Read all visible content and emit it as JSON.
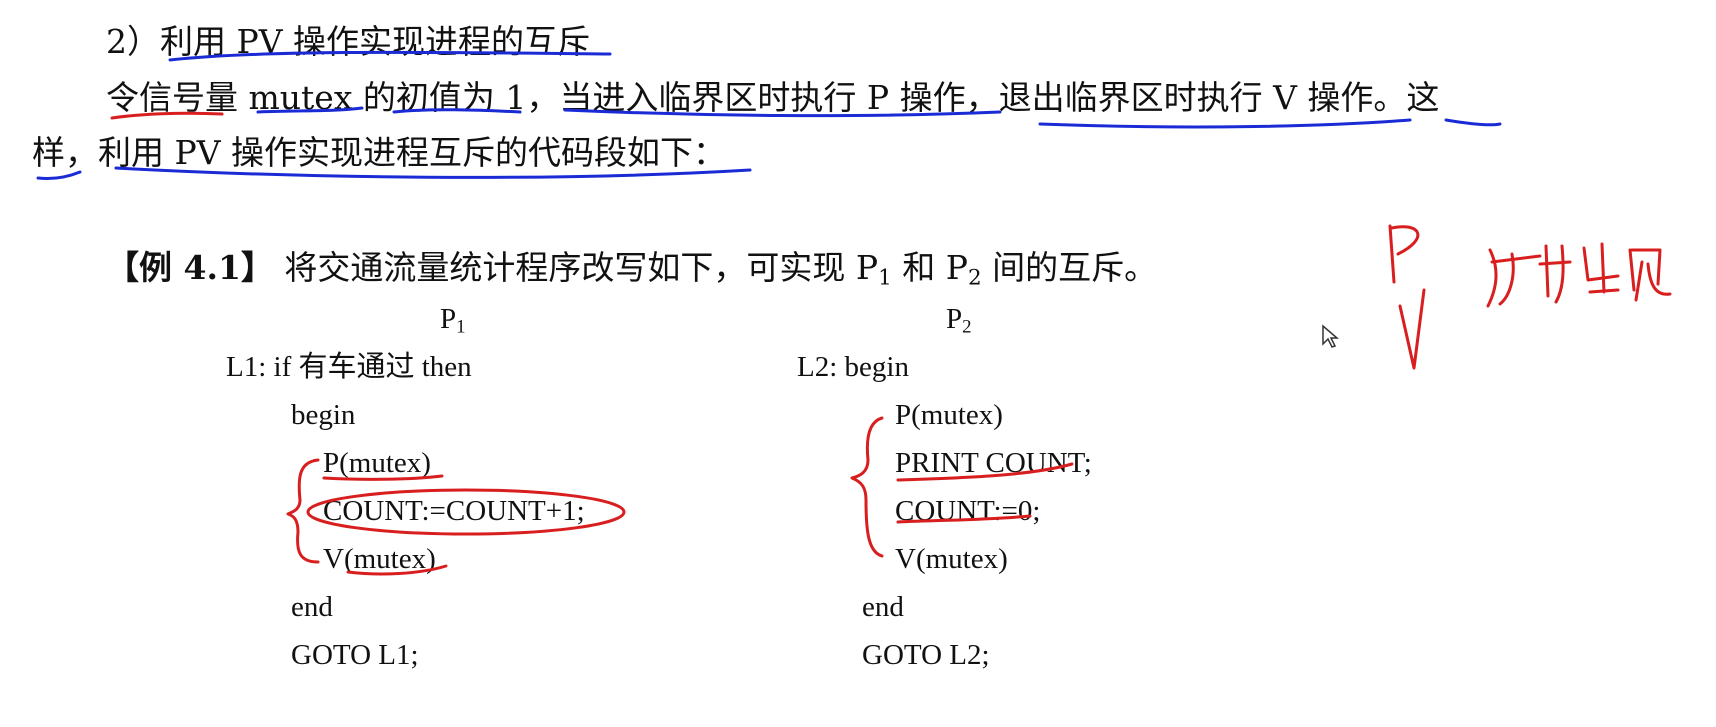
{
  "section": {
    "heading": "2）利用 PV 操作实现进程的互斥",
    "para_line1": "令信号量 mutex 的初值为 1，当进入临界区时执行 P 操作，退出临界区时执行 V 操作。这",
    "para_line2": "样，利用 PV 操作实现进程互斥的代码段如下："
  },
  "example": {
    "tag": "【例 4.1】",
    "text_before": "将交通流量统计程序改写如下，可实现 P",
    "sub1": "1",
    "text_mid": " 和 P",
    "sub2": "2",
    "text_after": " 间的互斥。"
  },
  "p1": {
    "title": "P",
    "title_sub": "1",
    "lines": [
      "L1: if  有车通过  then",
      "begin",
      "P(mutex)",
      "COUNT:=COUNT+1;",
      "V(mutex)",
      "end",
      "GOTO L1;"
    ]
  },
  "p2": {
    "title": "P",
    "title_sub": "2",
    "lines": [
      "L2: begin",
      "P(mutex)",
      "PRINT COUNT;",
      "COUNT:=0;",
      "V(mutex)",
      "end",
      "GOTO L2;"
    ]
  },
  "colors": {
    "ink_blue": "#1a2bd6",
    "ink_red": "#d81e1e"
  }
}
